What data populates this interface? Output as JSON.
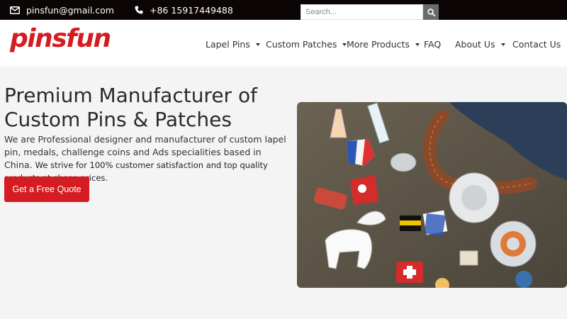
{
  "topbar": {
    "email": "pinsfun@gmail.com",
    "email_icon": "mail-icon",
    "phone": "+86 15917449488",
    "phone_icon": "phone-icon",
    "search_placeholder": "Search...",
    "search_icon": "search-icon"
  },
  "header": {
    "logo": "pinsfun",
    "nav": [
      {
        "label": "Lapel Pins",
        "dropdown": true
      },
      {
        "label": "Custom Patches",
        "dropdown": true
      },
      {
        "label": "More Products",
        "dropdown": true
      },
      {
        "label": "FAQ",
        "dropdown": false
      },
      {
        "label": "About Us",
        "dropdown": true
      },
      {
        "label": "Contact Us",
        "dropdown": false
      }
    ]
  },
  "hero": {
    "title_line1": "Premium Manufacturer of",
    "title_line2": "Custom Pins & Patches",
    "desc_main": "We are Professional designer and manufacturer of custom lapel pin, medals, challenge coins and Ads specialities based in China.",
    "desc_extra": "We strive for 100% customer satisfaction and top quality products at cheap prices.",
    "cta_label": "Get a Free Quote"
  },
  "colors": {
    "brand": "#d41c22",
    "topbar_bg": "#0c0505",
    "page_bg": "#f4f4f4"
  }
}
